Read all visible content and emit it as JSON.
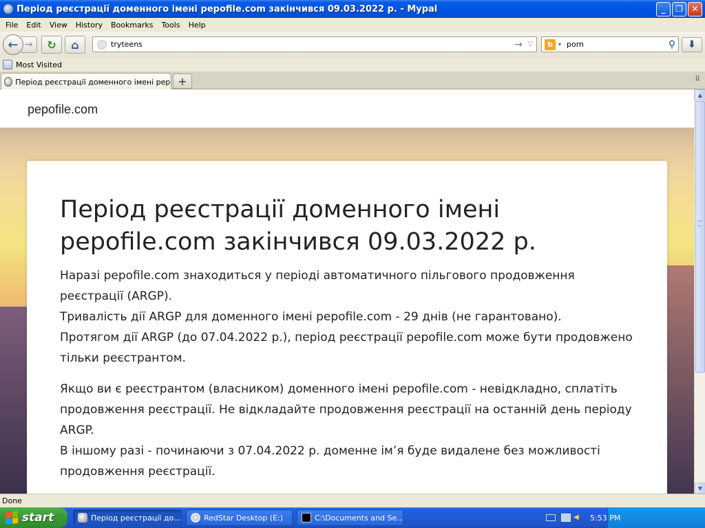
{
  "window": {
    "title": "Період реєстрації доменного імені pepofile.com закінчився 09.03.2022 р. - Mypal",
    "min_glyph": "_",
    "max_glyph": "❐",
    "close_glyph": "✕"
  },
  "menu": [
    "File",
    "Edit",
    "View",
    "History",
    "Bookmarks",
    "Tools",
    "Help"
  ],
  "nav": {
    "back_glyph": "←",
    "forward_glyph": "→",
    "reload_glyph": "↻",
    "home_glyph": "⌂",
    "url_value": "tryteens",
    "go_glyph": "→",
    "drop_glyph": "▽",
    "search_engine_glyph": "b",
    "search_engine_drop": "▾",
    "search_value": "porn",
    "search_glyph": "⚲",
    "download_glyph": "⬇"
  },
  "bookmarks": {
    "items": [
      {
        "label": "Most Visited"
      }
    ]
  },
  "tabs": {
    "items": [
      {
        "label": "Період реєстрації доменного імені pepofile.…"
      }
    ],
    "new_tab_glyph": "+",
    "list_glyph": "⠿"
  },
  "page": {
    "brand": "pepofile.com",
    "heading": "Період реєстрації доменного імені pepofile.com закінчився 09.03.2022 р.",
    "lines": [
      "Наразі pepofile.com знаходиться у періоді автоматичного пільгового продовження реєстрації (ARGP).",
      "Тривалість дії ARGP для доменного імені pepofile.com - 29 днів (не гарантовано).",
      "Протягом дії ARGP (до 07.04.2022 р.), період реєстрації pepofile.com може бути продовжено тільки реєстрантом."
    ],
    "lines2": [
      "Якщо ви є реєстрантом (власником) доменного імені pepofile.com - невідкладно, сплатіть продовження реєстрації. Не відкладайте продовження реєстрації на останній день періоду ARGP.",
      "В іншому разі - починаючи з 07.04.2022 р. доменне ім’я буде видалене без можливості продовження реєстрації."
    ]
  },
  "scrollbar": {
    "up_glyph": "▲",
    "down_glyph": "▼"
  },
  "status": {
    "text": "Done"
  },
  "taskbar": {
    "start_label": "start",
    "tasks": [
      {
        "label": "Період реєстрації до..."
      },
      {
        "label": "RedStar Desktop (E:)"
      },
      {
        "label": "C:\\Documents and Se..."
      }
    ],
    "clock": "5:53 PM",
    "volume_glyph": "◀"
  },
  "colors": {
    "titlebar": "#0054e3",
    "taskbar": "#245edb",
    "start": "#3c9a38",
    "tray": "#0f7fd8"
  }
}
